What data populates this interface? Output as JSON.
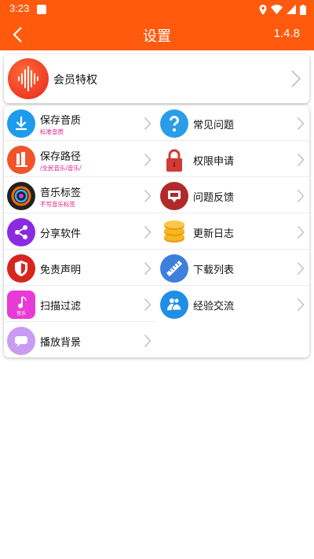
{
  "status_bar": {
    "time": "3:23"
  },
  "header": {
    "title": "设置",
    "version": "1.4.8"
  },
  "vip": {
    "label": "会员特权"
  },
  "left_items": [
    {
      "label": "保存音质",
      "sub": "标准音质"
    },
    {
      "label": "保存路径",
      "sub": "/全民音乐/音乐/"
    },
    {
      "label": "音乐标签",
      "sub": "不写音乐标签"
    },
    {
      "label": "分享软件",
      "sub": ""
    },
    {
      "label": "免责声明",
      "sub": ""
    },
    {
      "label": "扫描过滤",
      "sub": ""
    },
    {
      "label": "播放背景",
      "sub": ""
    }
  ],
  "right_items": [
    {
      "label": "常见问题"
    },
    {
      "label": "权限申请"
    },
    {
      "label": "问题反馈"
    },
    {
      "label": "更新日志"
    },
    {
      "label": "下载列表"
    },
    {
      "label": "经验交流"
    }
  ],
  "icon_texts": {
    "music_note_caption": "音乐"
  },
  "colors": {
    "brand_orange": "#ff5a0e",
    "subtext_magenta": "#e0188a"
  }
}
